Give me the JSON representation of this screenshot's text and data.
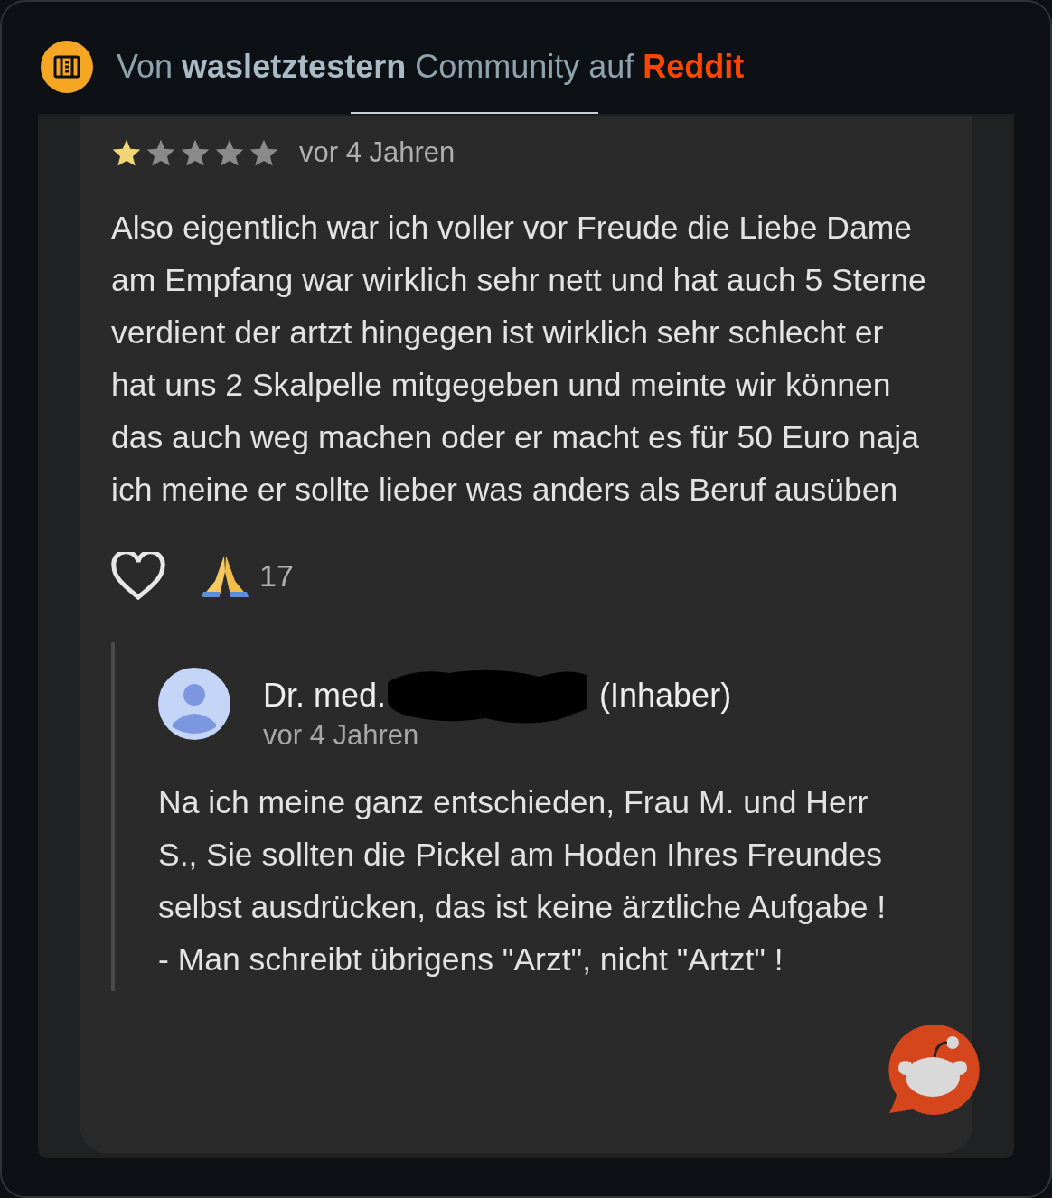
{
  "header": {
    "prefix": "Von",
    "community": "wasletztestern",
    "middle": "Community auf",
    "site": "Reddit"
  },
  "review": {
    "stars": 1,
    "time": "vor 4 Jahren",
    "text": "Also eigentlich war ich voller vor Freude die Liebe Dame am Empfang war wirklich sehr nett und hat auch 5 Sterne verdient der artzt hingegen ist wirklich sehr schlecht er hat uns 2 Skalpelle mitgegeben und meinte wir können das auch weg machen oder er macht es für 50 Euro naja ich meine er sollte lieber was anders als Beruf ausüben",
    "liked": false,
    "reaction_count": "17"
  },
  "reply": {
    "name_prefix": "Dr. med.",
    "name_suffix": "(Inhaber)",
    "time": "vor 4 Jahren",
    "text": "Na ich meine ganz entschieden, Frau M. und Herr S., Sie sollten die Pickel am Hoden Ihres Freundes selbst ausdrücken, das ist keine ärztliche Aufgabe ! - Man schreibt übrigens \"Arzt\", nicht \"Artzt\" !"
  }
}
